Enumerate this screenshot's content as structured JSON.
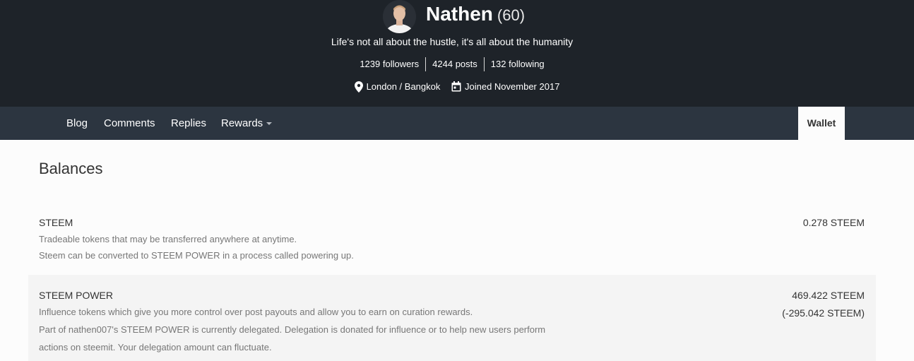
{
  "profile": {
    "name": "Nathen",
    "reputation": "(60)",
    "about": "Life's not all about the hustle, it's all about the humanity",
    "stats": {
      "followers": "1239 followers",
      "posts": "4244 posts",
      "following": "132 following"
    },
    "location": "London / Bangkok",
    "joined": "Joined November 2017",
    "icons": {
      "location": "location-pin-icon",
      "joined": "calendar-icon"
    }
  },
  "nav": {
    "items": [
      {
        "label": "Blog"
      },
      {
        "label": "Comments"
      },
      {
        "label": "Replies"
      },
      {
        "label": "Rewards"
      }
    ],
    "active_tab": "Wallet"
  },
  "balances": {
    "title": "Balances",
    "steem": {
      "title": "STEEM",
      "desc": [
        "Tradeable tokens that may be transferred anywhere at anytime.",
        "Steem can be converted to STEEM POWER in a process called powering up."
      ],
      "amount": "0.278 STEEM"
    },
    "steem_power": {
      "title": "STEEM POWER",
      "desc": [
        "Influence tokens which give you more control over post payouts and allow you to earn on curation rewards.",
        "Part of nathen007's STEEM POWER is currently delegated. Delegation is donated for influence or to help new users perform",
        "actions on steemit. Your delegation amount can fluctuate."
      ],
      "amount": "469.422 STEEM",
      "delegated": "(-295.042 STEEM)"
    }
  },
  "colors": {
    "header_bg": "#1e2329",
    "nav_bg": "#2c3540",
    "page_bg": "#fcfcfc",
    "alt_row_bg": "#f4f4f4"
  }
}
